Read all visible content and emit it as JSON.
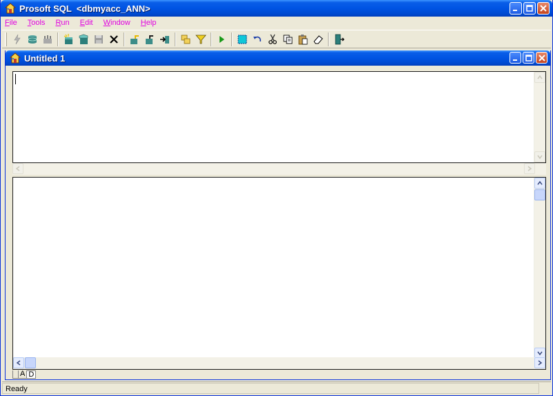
{
  "app": {
    "title": "Prosoft SQL  <dbmyacc_ANN>"
  },
  "menu": [
    {
      "label": "File",
      "key": "F",
      "rest": "ile"
    },
    {
      "label": "Tools",
      "key": "T",
      "rest": "ools"
    },
    {
      "label": "Run",
      "key": "R",
      "rest": "un"
    },
    {
      "label": "Edit",
      "key": "E",
      "rest": "dit"
    },
    {
      "label": "Window",
      "key": "W",
      "rest": "indow"
    },
    {
      "label": "Help",
      "key": "H",
      "rest": "elp"
    }
  ],
  "toolbar_icons": [
    "connect-icon",
    "database-icon",
    "disconnect-icon",
    "new-query-icon",
    "open-icon",
    "save-icon",
    "delete-icon",
    "commit-icon",
    "rollback-icon",
    "export-icon",
    "copy-record-icon",
    "filter-icon",
    "run-icon",
    "select-all-icon",
    "undo-icon",
    "cut-icon",
    "copy-icon",
    "paste-icon",
    "eraser-icon",
    "exit-icon"
  ],
  "child": {
    "title": "Untitled 1"
  },
  "result_tabs": [
    "",
    "A",
    "D"
  ],
  "status": {
    "text": "Ready"
  },
  "colors": {
    "menu_text": "#e000e0",
    "titlebar": "#0054e3",
    "face": "#ece9d8"
  }
}
